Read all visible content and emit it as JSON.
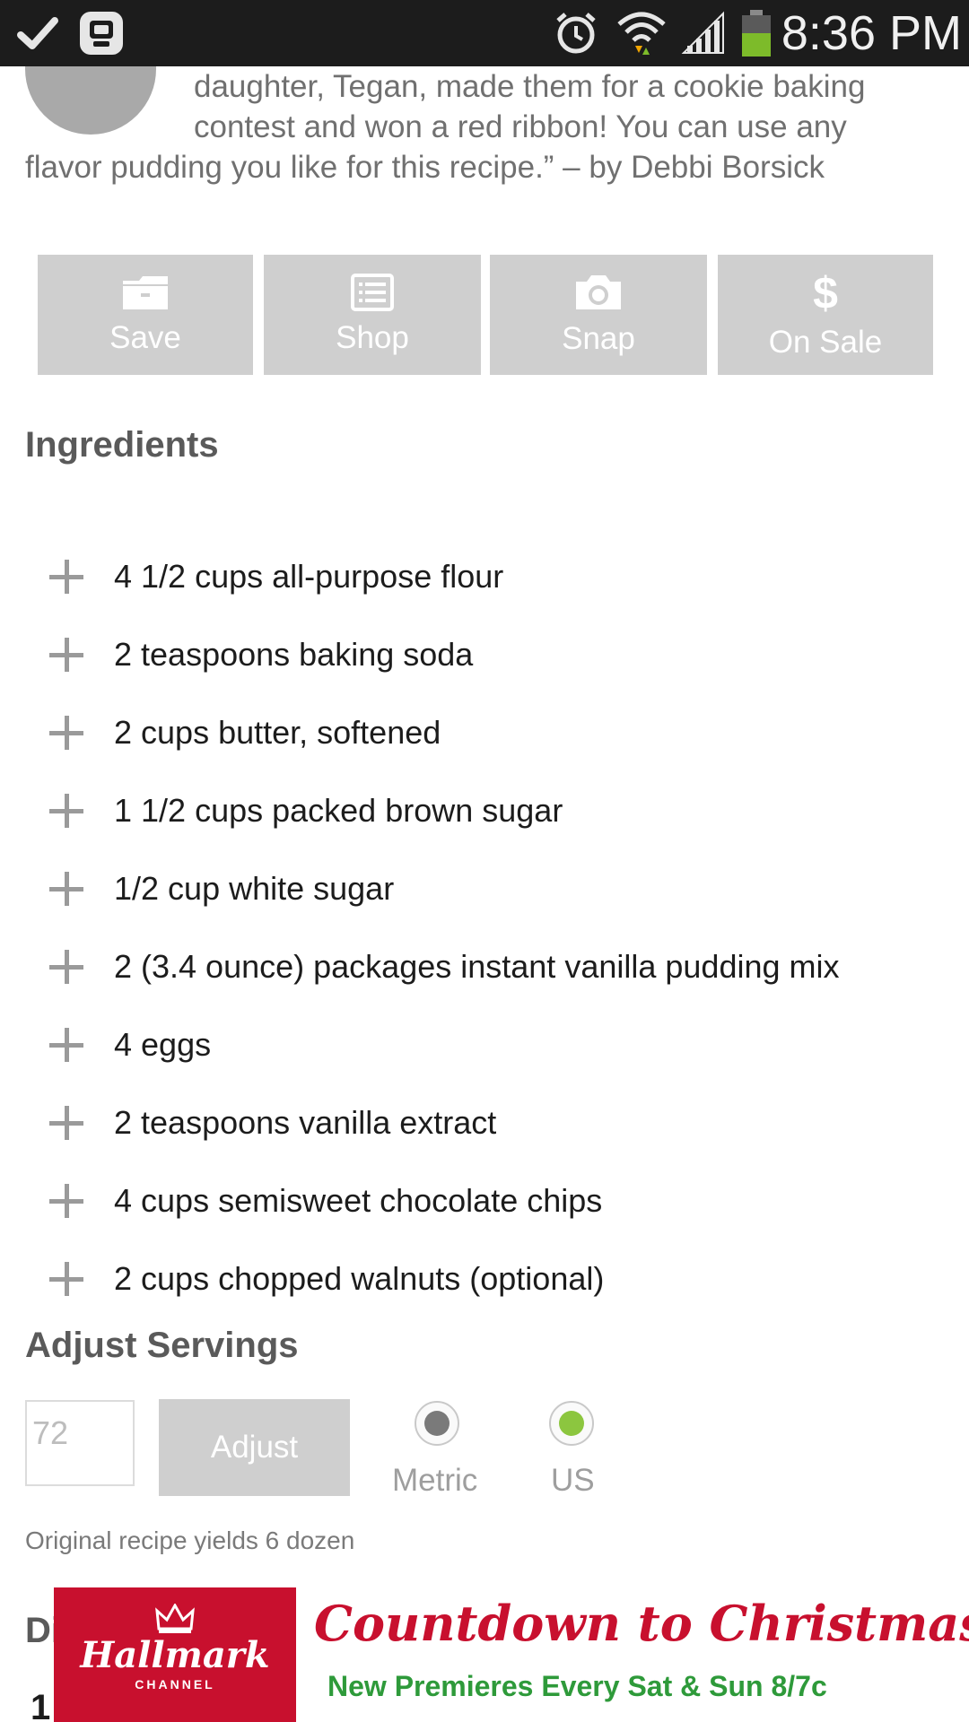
{
  "status_bar": {
    "time": "8:36 PM",
    "icons": [
      "check-icon",
      "app-notification-icon",
      "alarm-icon",
      "wifi-icon",
      "signal-icon",
      "battery-icon"
    ]
  },
  "recipe": {
    "description_lines": [
      "daughter, Tegan, made them for a cookie baking",
      "contest and won a red ribbon! You can use any",
      "flavor pudding you like for this recipe.” – by Debbi Borsick"
    ]
  },
  "actions": [
    {
      "label": "Save",
      "icon": "folder-icon"
    },
    {
      "label": "Shop",
      "icon": "list-icon"
    },
    {
      "label": "Snap",
      "icon": "camera-icon"
    },
    {
      "label": "On Sale",
      "icon": "dollar-icon"
    }
  ],
  "ingredients": {
    "heading": "Ingredients",
    "items": [
      "4 1/2 cups all-purpose flour",
      "2 teaspoons baking soda",
      "2 cups butter, softened",
      "1 1/2 cups packed brown sugar",
      "1/2 cup white sugar",
      "2 (3.4 ounce) packages instant vanilla pudding mix",
      "4 eggs",
      "2 teaspoons vanilla extract",
      "4 cups semisweet chocolate chips",
      "2 cups chopped walnuts (optional)"
    ]
  },
  "servings": {
    "heading": "Adjust Servings",
    "placeholder": "72",
    "adjust_label": "Adjust",
    "metric_label": "Metric",
    "us_label": "US",
    "selected_unit": "US",
    "yields_text": "Original recipe yields 6 dozen"
  },
  "next_section": {
    "heading_partial": "Di",
    "number_partial": "1"
  },
  "ad": {
    "brand": "Hallmark",
    "brand_sub": "CHANNEL",
    "title": "Countdown to Christmas",
    "subtitle": "New Premieres Every Sat & Sun 8/7c"
  },
  "colors": {
    "status_bar_bg": "#1c1c1c",
    "button_bg": "#cfcfcf",
    "radio_selected": "#8cc63f",
    "radio_unselected": "#7a7a7a",
    "ad_red": "#c8102e",
    "ad_green": "#2e9a3a"
  }
}
